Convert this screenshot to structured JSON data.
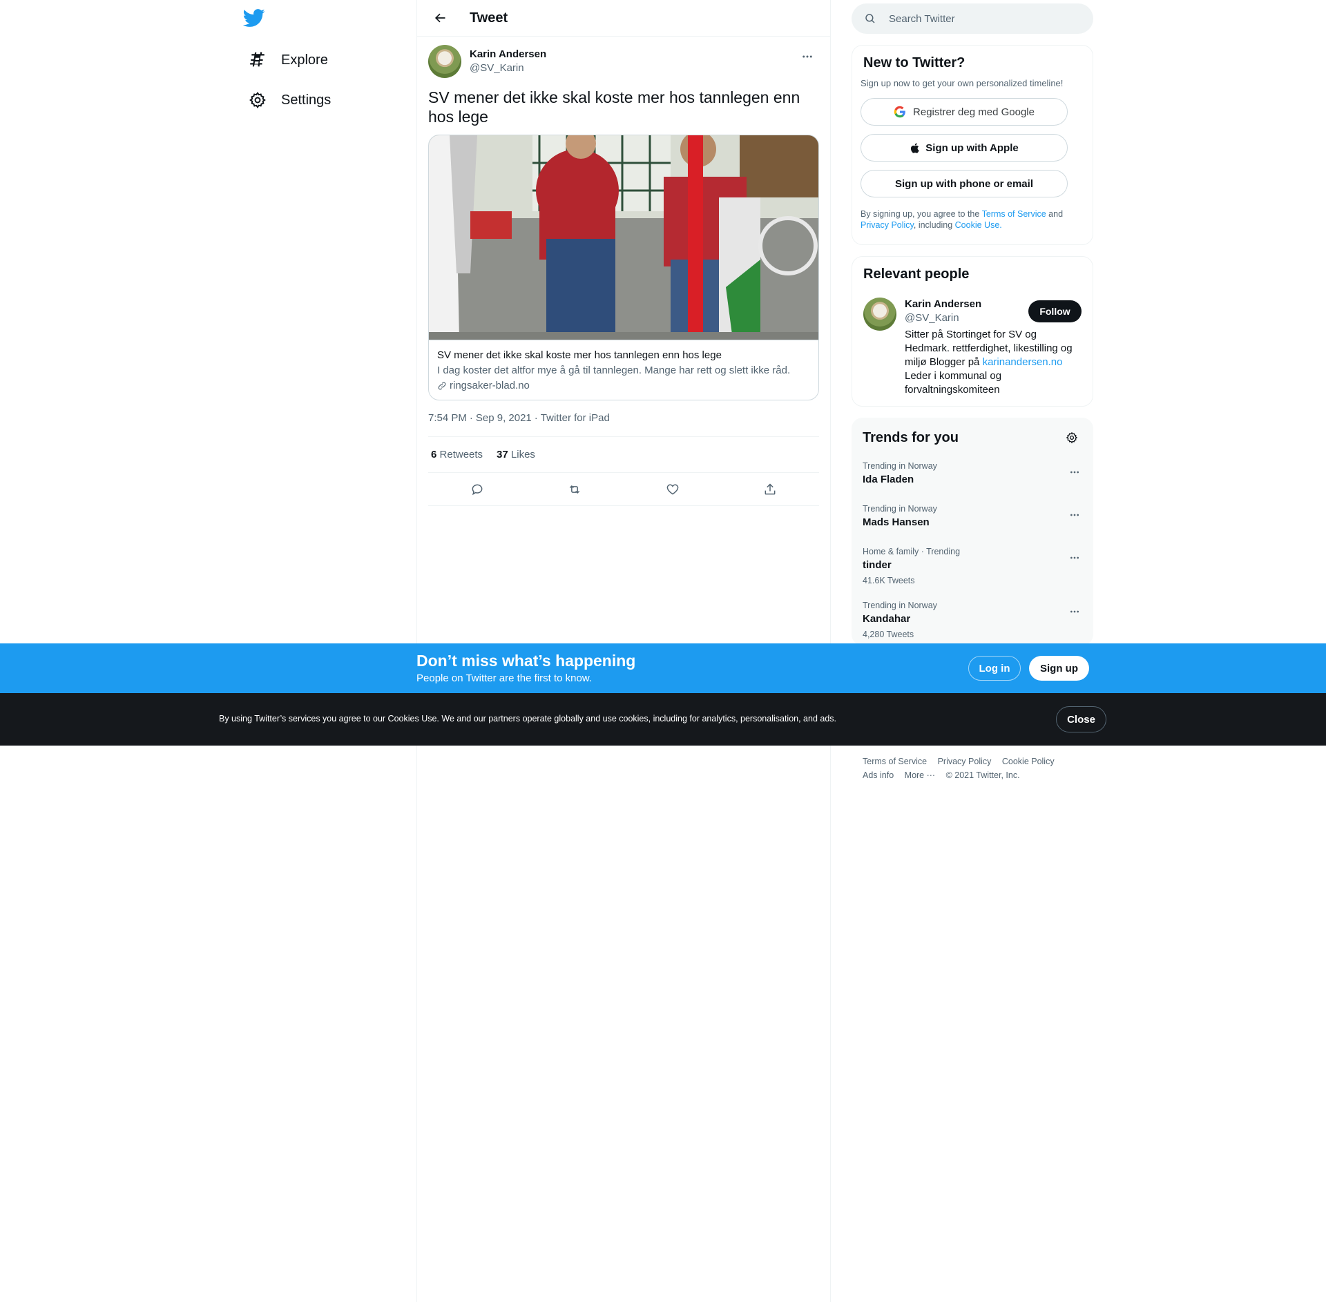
{
  "nav": {
    "logo_icon": "twitter-bird-icon",
    "items": [
      {
        "label": "Explore",
        "icon": "hashtag-icon"
      },
      {
        "label": "Settings",
        "icon": "gear-icon"
      }
    ]
  },
  "header": {
    "title": "Tweet",
    "back_icon": "arrow-left-icon"
  },
  "tweet": {
    "author_name": "Karin Andersen",
    "author_handle": "@SV_Karin",
    "text": "SV mener det ikke skal koste mer hos tannlegen enn hos lege",
    "card": {
      "title": "SV mener det ikke skal koste mer hos tannlegen enn hos lege",
      "description": "I dag koster det altfor mye å gå til tannlegen. Mange har rett og slett ikke råd.",
      "domain": "ringsaker-blad.no"
    },
    "time": "7:54 PM",
    "date": "Sep 9, 2021",
    "source": "Twitter for iPad",
    "retweets_count": "6",
    "retweets_label": "Retweets",
    "likes_count": "37",
    "likes_label": "Likes"
  },
  "search": {
    "placeholder": "Search Twitter"
  },
  "signup": {
    "title": "New to Twitter?",
    "subtitle": "Sign up now to get your own personalized timeline!",
    "google_label": "Registrer deg med Google",
    "apple_label": "Sign up with Apple",
    "phone_label": "Sign up with phone or email",
    "legal_prefix": "By signing up, you agree to the",
    "terms": "Terms of Service",
    "and": "and",
    "privacy": "Privacy Policy",
    "including": ", including",
    "cookie": "Cookie Use."
  },
  "relevant": {
    "title": "Relevant people",
    "name": "Karin Andersen",
    "handle": "@SV_Karin",
    "follow_label": "Follow",
    "bio_1": "Sitter på Stortinget for SV og Hedmark. rettferdighet, likestilling og miljø Blogger på",
    "bio_link": "karinandersen.no",
    "bio_2": "Leder i kommunal og forvaltningskomiteen"
  },
  "trends": {
    "title": "Trends for you",
    "items": [
      {
        "context": "Trending in Norway",
        "name": "Ida Fladen",
        "count": ""
      },
      {
        "context": "Trending in Norway",
        "name": "Mads Hansen",
        "count": ""
      },
      {
        "context": "Home & family · Trending",
        "name": "tinder",
        "count": "41.6K Tweets"
      },
      {
        "context": "Trending in Norway",
        "name": "Kandahar",
        "count": "4,280 Tweets"
      }
    ]
  },
  "footer": {
    "terms": "Terms of Service",
    "privacy": "Privacy Policy",
    "cookie": "Cookie Policy",
    "ads": "Ads info",
    "more": "More ···",
    "copyright": "© 2021 Twitter, Inc."
  },
  "banner": {
    "title": "Don’t miss what’s happening",
    "subtitle": "People on Twitter are the first to know.",
    "login": "Log in",
    "signup": "Sign up"
  },
  "cookie_bar": {
    "text": "By using Twitter’s services you agree to our Cookies Use. We and our partners operate globally and use cookies, including for analytics, personalisation, and ads.",
    "close": "Close"
  },
  "colors": {
    "accent": "#1d9bf0",
    "text": "#0f1419",
    "muted": "#536471",
    "dark": "#15181c"
  }
}
